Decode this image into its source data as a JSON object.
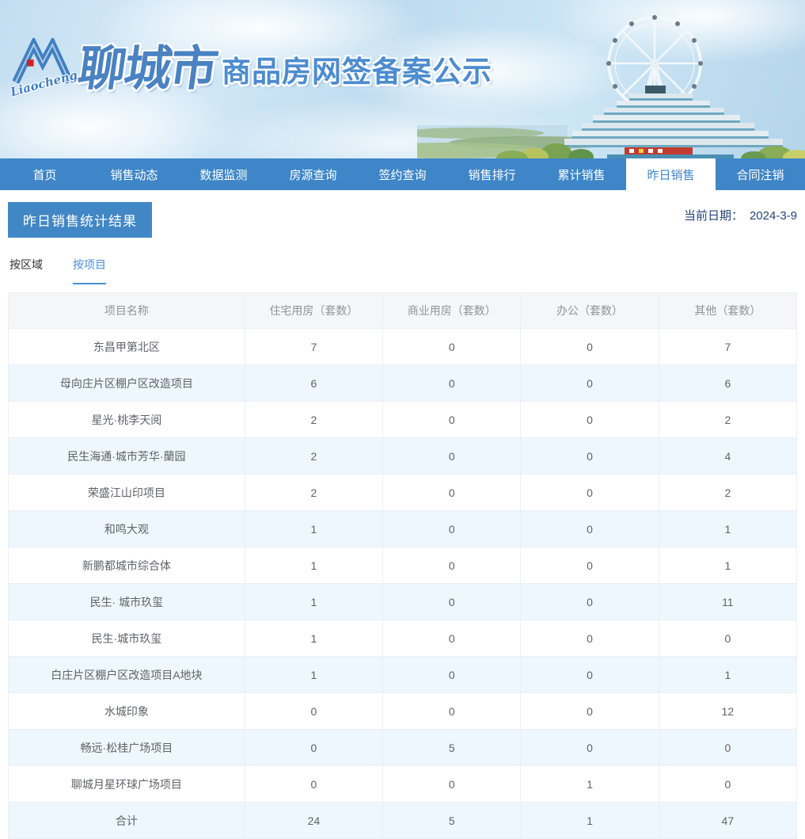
{
  "colors": {
    "nav-blue": "#3e86c7",
    "badge-blue": "#4287c5",
    "tab-active": "#4a90d9",
    "date-color": "#24477b",
    "table-header-bg": "#f5f6f7",
    "table-header-text": "#909399",
    "table-border": "#ebeef5",
    "cell-text": "#606266",
    "row-alt": "#eef7fe",
    "logo-red": "#cc2424"
  },
  "header": {
    "logo_script": "Liaocheng",
    "site_name": "聊城市",
    "site_subtitle": "商品房网签备案公示"
  },
  "nav": {
    "items": [
      {
        "label": "首页",
        "active": false
      },
      {
        "label": "销售动态",
        "active": false
      },
      {
        "label": "数据监测",
        "active": false
      },
      {
        "label": "房源查询",
        "active": false
      },
      {
        "label": "签约查询",
        "active": false
      },
      {
        "label": "销售排行",
        "active": false
      },
      {
        "label": "累计销售",
        "active": false
      },
      {
        "label": "昨日销售",
        "active": true
      },
      {
        "label": "合同注销",
        "active": false
      }
    ]
  },
  "page": {
    "title": "昨日销售统计结果",
    "date_label": "当前日期：",
    "date_value": "2024-3-9"
  },
  "tabs": [
    {
      "label": "按区域",
      "active": false
    },
    {
      "label": "按项目",
      "active": true
    }
  ],
  "table": {
    "columns": [
      "项目名称",
      "住宅用房（套数）",
      "商业用房（套数）",
      "办公（套数）",
      "其他（套数）"
    ],
    "rows": [
      [
        "东昌甲第北区",
        "7",
        "0",
        "0",
        "7"
      ],
      [
        "母向庄片区棚户区改造项目",
        "6",
        "0",
        "0",
        "6"
      ],
      [
        "星光·桃李天阅",
        "2",
        "0",
        "0",
        "2"
      ],
      [
        "民生海通·城市芳华·蘭园",
        "2",
        "0",
        "0",
        "4"
      ],
      [
        "荣盛江山印项目",
        "2",
        "0",
        "0",
        "2"
      ],
      [
        "和鸣大观",
        "1",
        "0",
        "0",
        "1"
      ],
      [
        "新鹏都城市综合体",
        "1",
        "0",
        "0",
        "1"
      ],
      [
        "民生· 城市玖玺",
        "1",
        "0",
        "0",
        "11"
      ],
      [
        "民生·城市玖玺",
        "1",
        "0",
        "0",
        "0"
      ],
      [
        "白庄片区棚户区改造项目A地块",
        "1",
        "0",
        "0",
        "1"
      ],
      [
        "水城印象",
        "0",
        "0",
        "0",
        "12"
      ],
      [
        "畅远·松桂广场项目",
        "0",
        "5",
        "0",
        "0"
      ],
      [
        "聊城月星环球广场项目",
        "0",
        "0",
        "1",
        "0"
      ],
      [
        "合计",
        "24",
        "5",
        "1",
        "47"
      ]
    ]
  }
}
